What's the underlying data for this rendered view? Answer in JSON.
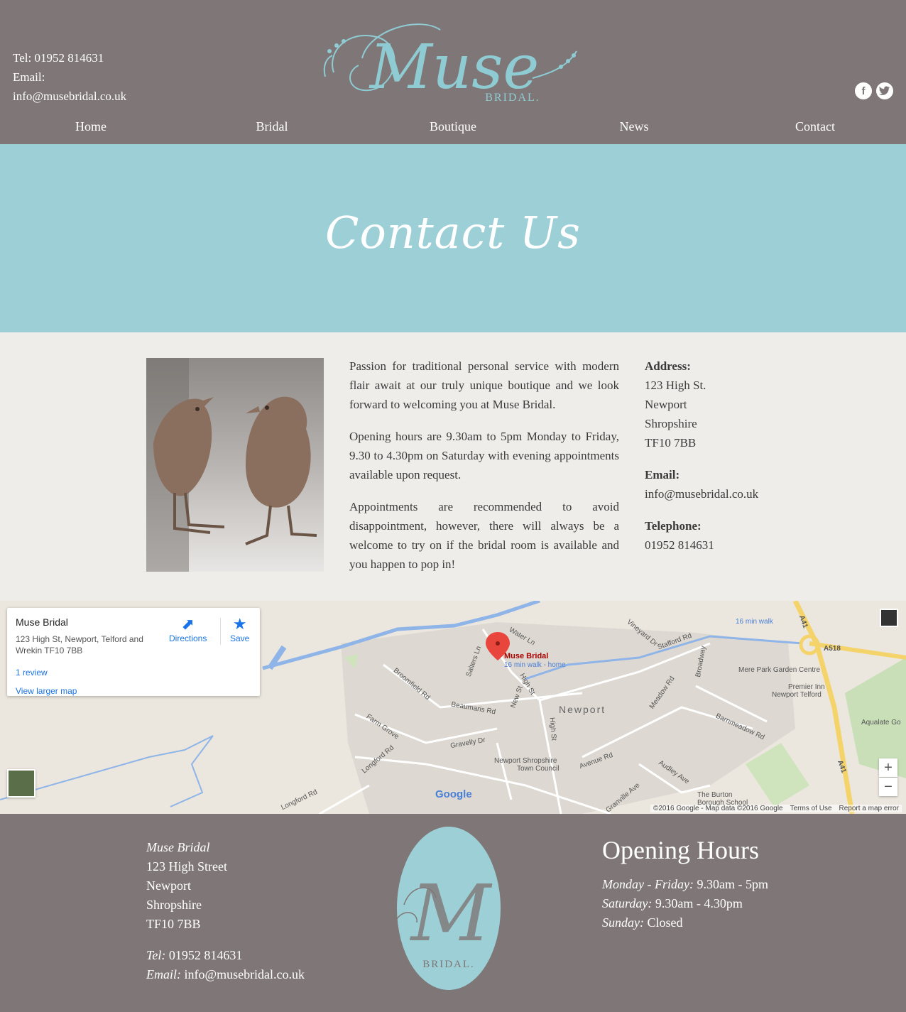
{
  "header": {
    "tel": "Tel: 01952 814631",
    "email_label": "Email:",
    "email": "info@musebridal.co.uk",
    "logo_text": "Muse",
    "logo_sub": "BRIDAL."
  },
  "social": {
    "facebook": "f",
    "twitter": "t"
  },
  "nav": [
    {
      "label": "Home"
    },
    {
      "label": "Bridal"
    },
    {
      "label": "Boutique"
    },
    {
      "label": "News"
    },
    {
      "label": "Contact"
    }
  ],
  "banner": {
    "title": "Contact Us",
    "color": "#9dd0d6"
  },
  "intro": {
    "p1": "Passion for traditional personal service with modern flair await at our truly unique boutique and we look forward to welcoming you at Muse Bridal.",
    "p2": "Opening hours are 9.30am to 5pm Monday to Friday, 9.30 to 4.30pm on Saturday with evening appointments available upon request.",
    "p3": "Appointments are recommended to avoid disappointment, however, there will always be a welcome to try on if the bridal room is available and you happen to pop in!"
  },
  "details": {
    "address_label": "Address:",
    "address_lines": [
      "123 High St.",
      "Newport",
      "Shropshire",
      "TF10 7BB"
    ],
    "email_label": "Email:",
    "email": "info@musebridal.co.uk",
    "tel_label": "Telephone:",
    "tel": "01952 814631"
  },
  "map": {
    "place_name": "Muse Bridal",
    "place_address": "123 High St, Newport, Telford and Wrekin TF10 7BB",
    "reviews": "1 review",
    "larger_map": "View larger map",
    "directions": "Directions",
    "save": "Save",
    "pin_label": "Muse Bridal",
    "pin_sub": "16 min walk - home",
    "walk_label": "16 min walk",
    "town": "Newport",
    "labels": {
      "water_ln": "Water Ln",
      "stafford_rd": "Stafford Rd",
      "a518": "A518",
      "a41": "A41",
      "a41b": "A41",
      "mere_park": "Mere Park Garden Centre",
      "premier_inn": "Premier Inn",
      "premier_inn2": "Newport Telford",
      "aqualate": "Aqualate Go",
      "broomfield": "Broomfield Rd",
      "beaumaris": "Beaumaris Rd",
      "farm_grove": "Farm Grove",
      "gravelly": "Gravelly Dr",
      "longford": "Longford Rd",
      "longford2": "Longford Rd",
      "council": "Newport Shropshire",
      "council2": "Town Council",
      "avenue": "Avenue Rd",
      "audley": "Audley Ave",
      "meadow": "Meadow Rd",
      "barnmeadow": "Barnmeadow Rd",
      "burton": "The Burton",
      "burton2": "Borough School",
      "high_st": "High St",
      "high_st2": "High St",
      "new_st": "New St",
      "salters": "Salters Ln",
      "vineyard": "Vineyard Dr",
      "broadway": "Broadway",
      "granville": "Granville Ave"
    },
    "google": "Google",
    "copyright": "©2016 Google - Map data ©2016 Google",
    "terms": "Terms of Use",
    "report": "Report a map error",
    "zoom_in": "+",
    "zoom_out": "−"
  },
  "footer": {
    "name": "Muse Bridal",
    "address_lines": [
      "123 High Street",
      "Newport",
      "Shropshire",
      "TF10 7BB"
    ],
    "tel_label": "Tel:",
    "tel": "01952 814631",
    "email_label": "Email:",
    "email": "info@musebridal.co.uk",
    "logo_letter": "M",
    "logo_sub": "BRIDAL.",
    "hours_title": "Opening Hours",
    "hours": [
      {
        "day": "Monday - Friday:",
        "time": "9.30am - 5pm"
      },
      {
        "day": "Saturday:",
        "time": "9.30am - 4.30pm"
      },
      {
        "day": "Sunday:",
        "time": "Closed"
      }
    ]
  },
  "colors": {
    "header_bg": "#7f7777",
    "accent": "#8fcbd2",
    "content_bg": "#efedea"
  }
}
